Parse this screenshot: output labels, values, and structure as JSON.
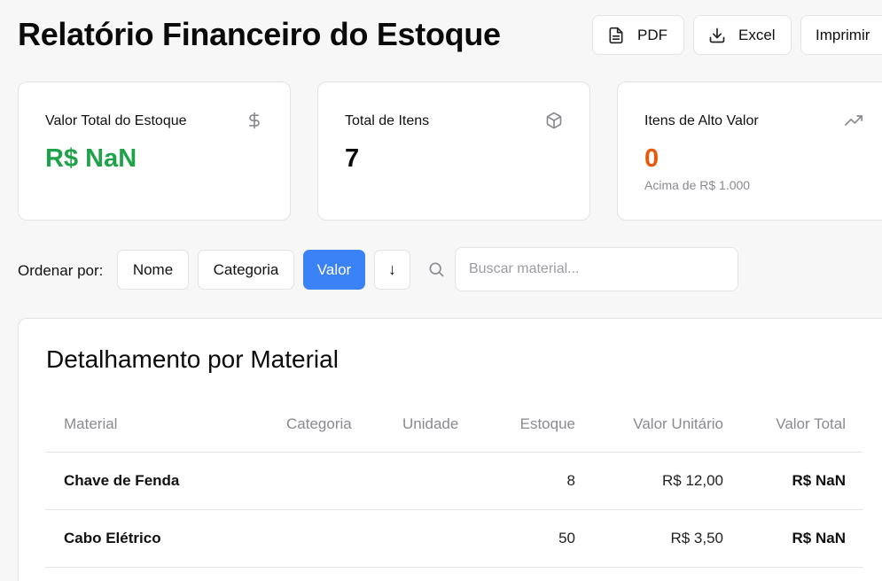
{
  "header": {
    "title": "Relatório Financeiro do Estoque",
    "buttons": {
      "pdf": "PDF",
      "excel": "Excel",
      "print": "Imprimir"
    }
  },
  "cards": {
    "total_value": {
      "label": "Valor Total do Estoque",
      "value": "R$ NaN",
      "icon": "dollar-icon"
    },
    "total_items": {
      "label": "Total de Itens",
      "value": "7",
      "icon": "box-icon"
    },
    "high_value": {
      "label": "Itens de Alto Valor",
      "value": "0",
      "sub": "Acima de R$ 1.000",
      "icon": "trending-up-icon"
    }
  },
  "sort": {
    "label": "Ordenar por:",
    "options": [
      "Nome",
      "Categoria",
      "Valor"
    ],
    "selected": "Valor",
    "direction": "↓"
  },
  "search": {
    "placeholder": "Buscar material..."
  },
  "table": {
    "title": "Detalhamento por Material",
    "columns": [
      "Material",
      "Categoria",
      "Unidade",
      "Estoque",
      "Valor Unitário",
      "Valor Total"
    ],
    "rows": [
      {
        "material": "Chave de Fenda",
        "categoria": "",
        "unidade": "",
        "estoque": "8",
        "valor_unitario": "R$ 12,00",
        "valor_total": "R$ NaN"
      },
      {
        "material": "Cabo Elétrico",
        "categoria": "",
        "unidade": "",
        "estoque": "50",
        "valor_unitario": "R$ 3,50",
        "valor_total": "R$ NaN"
      }
    ]
  },
  "colors": {
    "accent": "#3b82f6",
    "positive": "#1fa34a",
    "warning": "#ea580c"
  }
}
